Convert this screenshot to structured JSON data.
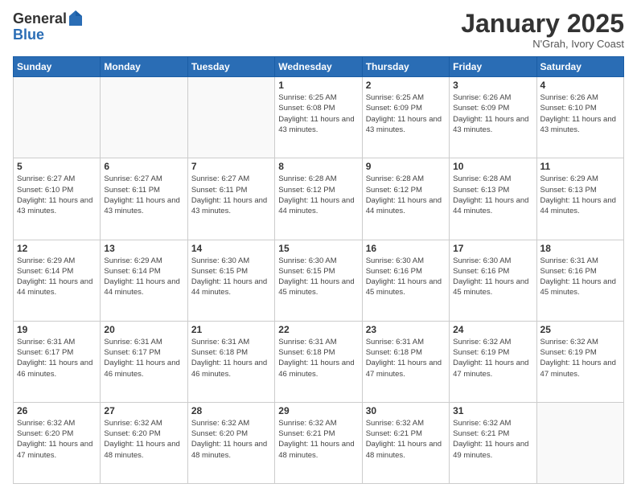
{
  "logo": {
    "general": "General",
    "blue": "Blue"
  },
  "header": {
    "month": "January 2025",
    "location": "N'Grah, Ivory Coast"
  },
  "weekdays": [
    "Sunday",
    "Monday",
    "Tuesday",
    "Wednesday",
    "Thursday",
    "Friday",
    "Saturday"
  ],
  "weeks": [
    [
      {
        "day": "",
        "info": ""
      },
      {
        "day": "",
        "info": ""
      },
      {
        "day": "",
        "info": ""
      },
      {
        "day": "1",
        "sunrise": "6:25 AM",
        "sunset": "6:08 PM",
        "daylight": "11 hours and 43 minutes."
      },
      {
        "day": "2",
        "sunrise": "6:25 AM",
        "sunset": "6:09 PM",
        "daylight": "11 hours and 43 minutes."
      },
      {
        "day": "3",
        "sunrise": "6:26 AM",
        "sunset": "6:09 PM",
        "daylight": "11 hours and 43 minutes."
      },
      {
        "day": "4",
        "sunrise": "6:26 AM",
        "sunset": "6:10 PM",
        "daylight": "11 hours and 43 minutes."
      }
    ],
    [
      {
        "day": "5",
        "sunrise": "6:27 AM",
        "sunset": "6:10 PM",
        "daylight": "11 hours and 43 minutes."
      },
      {
        "day": "6",
        "sunrise": "6:27 AM",
        "sunset": "6:11 PM",
        "daylight": "11 hours and 43 minutes."
      },
      {
        "day": "7",
        "sunrise": "6:27 AM",
        "sunset": "6:11 PM",
        "daylight": "11 hours and 43 minutes."
      },
      {
        "day": "8",
        "sunrise": "6:28 AM",
        "sunset": "6:12 PM",
        "daylight": "11 hours and 44 minutes."
      },
      {
        "day": "9",
        "sunrise": "6:28 AM",
        "sunset": "6:12 PM",
        "daylight": "11 hours and 44 minutes."
      },
      {
        "day": "10",
        "sunrise": "6:28 AM",
        "sunset": "6:13 PM",
        "daylight": "11 hours and 44 minutes."
      },
      {
        "day": "11",
        "sunrise": "6:29 AM",
        "sunset": "6:13 PM",
        "daylight": "11 hours and 44 minutes."
      }
    ],
    [
      {
        "day": "12",
        "sunrise": "6:29 AM",
        "sunset": "6:14 PM",
        "daylight": "11 hours and 44 minutes."
      },
      {
        "day": "13",
        "sunrise": "6:29 AM",
        "sunset": "6:14 PM",
        "daylight": "11 hours and 44 minutes."
      },
      {
        "day": "14",
        "sunrise": "6:30 AM",
        "sunset": "6:15 PM",
        "daylight": "11 hours and 44 minutes."
      },
      {
        "day": "15",
        "sunrise": "6:30 AM",
        "sunset": "6:15 PM",
        "daylight": "11 hours and 45 minutes."
      },
      {
        "day": "16",
        "sunrise": "6:30 AM",
        "sunset": "6:16 PM",
        "daylight": "11 hours and 45 minutes."
      },
      {
        "day": "17",
        "sunrise": "6:30 AM",
        "sunset": "6:16 PM",
        "daylight": "11 hours and 45 minutes."
      },
      {
        "day": "18",
        "sunrise": "6:31 AM",
        "sunset": "6:16 PM",
        "daylight": "11 hours and 45 minutes."
      }
    ],
    [
      {
        "day": "19",
        "sunrise": "6:31 AM",
        "sunset": "6:17 PM",
        "daylight": "11 hours and 46 minutes."
      },
      {
        "day": "20",
        "sunrise": "6:31 AM",
        "sunset": "6:17 PM",
        "daylight": "11 hours and 46 minutes."
      },
      {
        "day": "21",
        "sunrise": "6:31 AM",
        "sunset": "6:18 PM",
        "daylight": "11 hours and 46 minutes."
      },
      {
        "day": "22",
        "sunrise": "6:31 AM",
        "sunset": "6:18 PM",
        "daylight": "11 hours and 46 minutes."
      },
      {
        "day": "23",
        "sunrise": "6:31 AM",
        "sunset": "6:18 PM",
        "daylight": "11 hours and 47 minutes."
      },
      {
        "day": "24",
        "sunrise": "6:32 AM",
        "sunset": "6:19 PM",
        "daylight": "11 hours and 47 minutes."
      },
      {
        "day": "25",
        "sunrise": "6:32 AM",
        "sunset": "6:19 PM",
        "daylight": "11 hours and 47 minutes."
      }
    ],
    [
      {
        "day": "26",
        "sunrise": "6:32 AM",
        "sunset": "6:20 PM",
        "daylight": "11 hours and 47 minutes."
      },
      {
        "day": "27",
        "sunrise": "6:32 AM",
        "sunset": "6:20 PM",
        "daylight": "11 hours and 48 minutes."
      },
      {
        "day": "28",
        "sunrise": "6:32 AM",
        "sunset": "6:20 PM",
        "daylight": "11 hours and 48 minutes."
      },
      {
        "day": "29",
        "sunrise": "6:32 AM",
        "sunset": "6:21 PM",
        "daylight": "11 hours and 48 minutes."
      },
      {
        "day": "30",
        "sunrise": "6:32 AM",
        "sunset": "6:21 PM",
        "daylight": "11 hours and 48 minutes."
      },
      {
        "day": "31",
        "sunrise": "6:32 AM",
        "sunset": "6:21 PM",
        "daylight": "11 hours and 49 minutes."
      },
      {
        "day": "",
        "info": ""
      }
    ]
  ]
}
